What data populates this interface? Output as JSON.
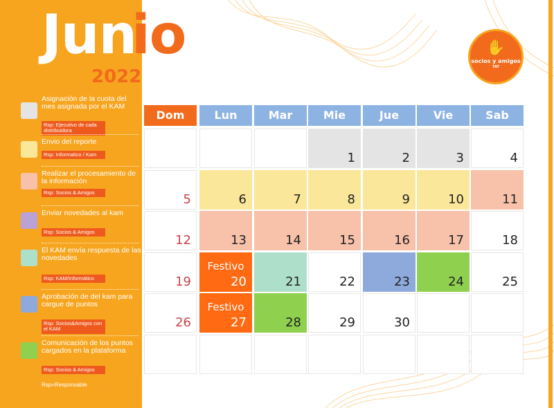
{
  "header": {
    "title_part1": "Jun",
    "title_part2": "io",
    "year": "2022",
    "logo_name": "socios y amigos",
    "logo_sub": "TAT"
  },
  "colors": {
    "sidebar": "#f7a51f",
    "accent": "#f26a1b",
    "header_blue": "#8db3e2",
    "sunday_header": "#f26a1b",
    "gray": "#e4e4e4",
    "yellow": "#fbe79a",
    "peach": "#f7c1aa",
    "purple": "#b8a2d6",
    "mint": "#aedfca",
    "blue": "#8ea9dc",
    "green": "#8fd14f",
    "festivo": "#ff6a13"
  },
  "legend": [
    {
      "text": "Asignación de la cuota del mes asignada por el KAM",
      "rsp": "Rsp: Ejecutivo de cada distribuidora",
      "color": "gray"
    },
    {
      "text": "Envio del reporte",
      "rsp": "Rsp: Informatico / Kam",
      "color": "yellow"
    },
    {
      "text": "Realizar el procesamiento de la información",
      "rsp": "Rsp: Socios & Amigos",
      "color": "peach"
    },
    {
      "text": "Enviar novedades al kam",
      "rsp": "Rsp: Socios & Amigos",
      "color": "purple"
    },
    {
      "text": "El KAM envía respuesta de las novedades",
      "rsp": "Rsp: KAM/Informático",
      "color": "mint"
    },
    {
      "text": "Aprobación de del kam para cargue de puntos",
      "rsp": "Rsp: Socios&Amigos con el KAM",
      "color": "blue"
    },
    {
      "text": "Comunicación de los puntos cargados en la plataforma",
      "rsp": "Rsp: Socios & Amigos",
      "color": "green"
    }
  ],
  "footnote": "Rsp=Responsable",
  "weekdays": [
    "Dom",
    "Lun",
    "Mar",
    "Mie",
    "Jue",
    "Vie",
    "Sab"
  ],
  "weeks": [
    [
      {
        "d": ""
      },
      {
        "d": ""
      },
      {
        "d": ""
      },
      {
        "d": "1",
        "c": "gray"
      },
      {
        "d": "2",
        "c": "gray"
      },
      {
        "d": "3",
        "c": "gray"
      },
      {
        "d": "4"
      }
    ],
    [
      {
        "d": "5"
      },
      {
        "d": "6",
        "c": "yellow"
      },
      {
        "d": "7",
        "c": "yellow"
      },
      {
        "d": "8",
        "c": "yellow"
      },
      {
        "d": "9",
        "c": "yellow"
      },
      {
        "d": "10",
        "c": "yellow"
      },
      {
        "d": "11",
        "c": "peach"
      }
    ],
    [
      {
        "d": "12"
      },
      {
        "d": "13",
        "c": "peach"
      },
      {
        "d": "14",
        "c": "peach"
      },
      {
        "d": "15",
        "c": "peach"
      },
      {
        "d": "16",
        "c": "peach"
      },
      {
        "d": "17",
        "c": "peach"
      },
      {
        "d": "18"
      }
    ],
    [
      {
        "d": "19"
      },
      {
        "d": "20",
        "c": "festivo",
        "label": "Festivo"
      },
      {
        "d": "21",
        "c": "mint"
      },
      {
        "d": "22"
      },
      {
        "d": "23",
        "c": "blue"
      },
      {
        "d": "24",
        "c": "green"
      },
      {
        "d": "25"
      }
    ],
    [
      {
        "d": "26"
      },
      {
        "d": "27",
        "c": "festivo",
        "label": "Festivo"
      },
      {
        "d": "28",
        "c": "green"
      },
      {
        "d": "29"
      },
      {
        "d": "30"
      },
      {
        "d": ""
      },
      {
        "d": ""
      }
    ],
    [
      {
        "d": ""
      },
      {
        "d": ""
      },
      {
        "d": ""
      },
      {
        "d": ""
      },
      {
        "d": ""
      },
      {
        "d": ""
      },
      {
        "d": ""
      }
    ]
  ]
}
